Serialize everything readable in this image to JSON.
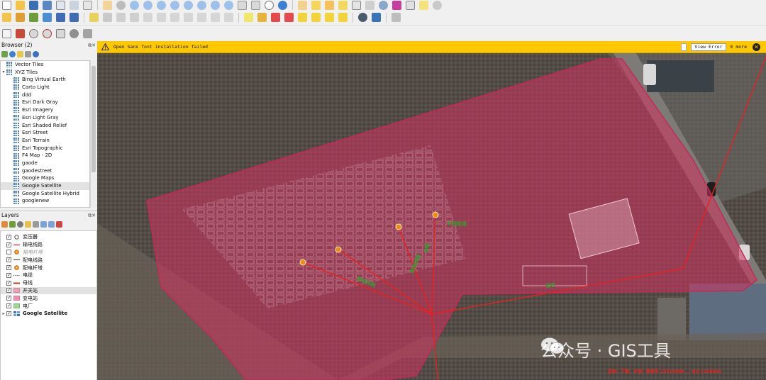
{
  "browser": {
    "title": "Browser (2)",
    "items": [
      {
        "label": "Vector Tiles",
        "indent": 0
      },
      {
        "label": "XYZ Tiles",
        "indent": 0
      },
      {
        "label": "Bing Virtual Earth",
        "indent": 1
      },
      {
        "label": "Carto Light",
        "indent": 1
      },
      {
        "label": "ddd",
        "indent": 1
      },
      {
        "label": "Esri Dark Gray",
        "indent": 1
      },
      {
        "label": "Esri Imagery",
        "indent": 1
      },
      {
        "label": "Esri Light Gray",
        "indent": 1
      },
      {
        "label": "Esri Shaded Relief",
        "indent": 1
      },
      {
        "label": "Esri Street",
        "indent": 1
      },
      {
        "label": "Esri Terrain",
        "indent": 1
      },
      {
        "label": "Esri Topographic",
        "indent": 1
      },
      {
        "label": "F4 Map - 2D",
        "indent": 1
      },
      {
        "label": "gaode",
        "indent": 1
      },
      {
        "label": "gaodestreet",
        "indent": 1
      },
      {
        "label": "Google Maps",
        "indent": 1
      },
      {
        "label": "Google Satellite",
        "indent": 1
      },
      {
        "label": "Google Satellite Hybrid",
        "indent": 1
      },
      {
        "label": "googlenew",
        "indent": 1
      }
    ]
  },
  "layers": {
    "title": "Layers",
    "items": [
      {
        "label": "变压器",
        "checked": true,
        "symbol": "circle-hollow",
        "style": "normal"
      },
      {
        "label": "输电线路",
        "checked": true,
        "symbol": "line-red",
        "style": "normal"
      },
      {
        "label": "输电杆塔",
        "checked": false,
        "symbol": "dot-orange",
        "style": "dim"
      },
      {
        "label": "配电线路",
        "checked": true,
        "symbol": "line-dark",
        "style": "normal"
      },
      {
        "label": "配电杆塔",
        "checked": true,
        "symbol": "dot-orange",
        "style": "normal"
      },
      {
        "label": "电缆",
        "checked": true,
        "symbol": "line-dotted",
        "style": "normal"
      },
      {
        "label": "母线",
        "checked": true,
        "symbol": "line-brown",
        "style": "normal"
      },
      {
        "label": "开关站",
        "checked": true,
        "symbol": "fill-pink",
        "style": "normal"
      },
      {
        "label": "变电站",
        "checked": true,
        "symbol": "fill-pink",
        "style": "normal"
      },
      {
        "label": "电厂",
        "checked": true,
        "symbol": "fill-green",
        "style": "normal"
      },
      {
        "label": "Google Satellite",
        "checked": true,
        "symbol": "raster",
        "style": "bold"
      }
    ]
  },
  "message_bar": {
    "text": "Open Sans font installation failed",
    "view_button": "View Error",
    "more": "≡ more"
  },
  "map": {
    "labels": [
      "平西街道",
      "输电线路",
      "配电线路",
      "电缆",
      "母线"
    ],
    "watermark": "公众号 · GIS工具",
    "contact": "定制、下载、开源：微信号 15510088 ... QQ 1150000"
  },
  "colors": {
    "substation_fill": "#d2325f",
    "line_red": "#e82020",
    "tower_orange": "#f08a10",
    "label_green": "#2fa12f",
    "message_bg": "#ffc800"
  }
}
